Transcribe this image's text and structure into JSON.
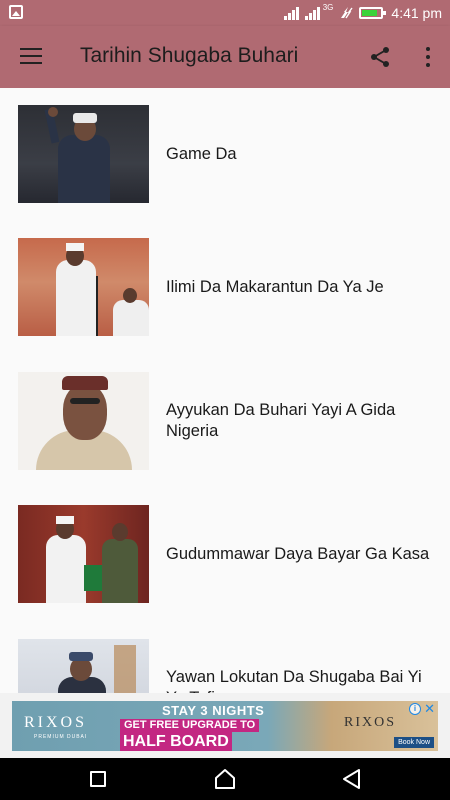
{
  "status_bar": {
    "network_label": "3G",
    "time": "4:41 pm",
    "battery_level": 0.85,
    "battery_color": "#3ad33a",
    "icons": [
      "gallery-icon",
      "signal-icon",
      "signal-icon",
      "data-saver-icon",
      "battery-icon"
    ]
  },
  "app_bar": {
    "title": "Tarihin Shugaba Buhari",
    "background_color": "#b06a72",
    "icons": [
      "menu-icon",
      "share-icon",
      "more-vert-icon"
    ]
  },
  "list": {
    "items": [
      {
        "title": "Game Da",
        "thumbnail": "photo-waving-man"
      },
      {
        "title": "Ilimi Da Makarantun Da Ya Je",
        "thumbnail": "photo-speaker-at-podium"
      },
      {
        "title": "Ayyukan Da Buhari Yayi A Gida Nigeria",
        "thumbnail": "photo-portrait"
      },
      {
        "title": "Gudummawar Daya Bayar Ga Kasa",
        "thumbnail": "photo-official-event"
      },
      {
        "title": "Yawan Lokutan Da Shugaba Bai Yi Ya Tafiya",
        "thumbnail": "photo-man-at-window"
      }
    ]
  },
  "ad": {
    "brand_left": "RIXOS",
    "brand_left_sub": "PREMIUM DUBAI",
    "headline": "STAY 3 NIGHTS",
    "subline": "GET FREE UPGRADE TO",
    "offer": "HALF BOARD",
    "brand_right": "RIXOS",
    "cta": "Book Now",
    "info": "i",
    "close": "✕",
    "accent_color": "#c32782"
  },
  "nav_bar": {
    "icons": [
      "recents-icon",
      "home-icon",
      "back-icon"
    ]
  }
}
